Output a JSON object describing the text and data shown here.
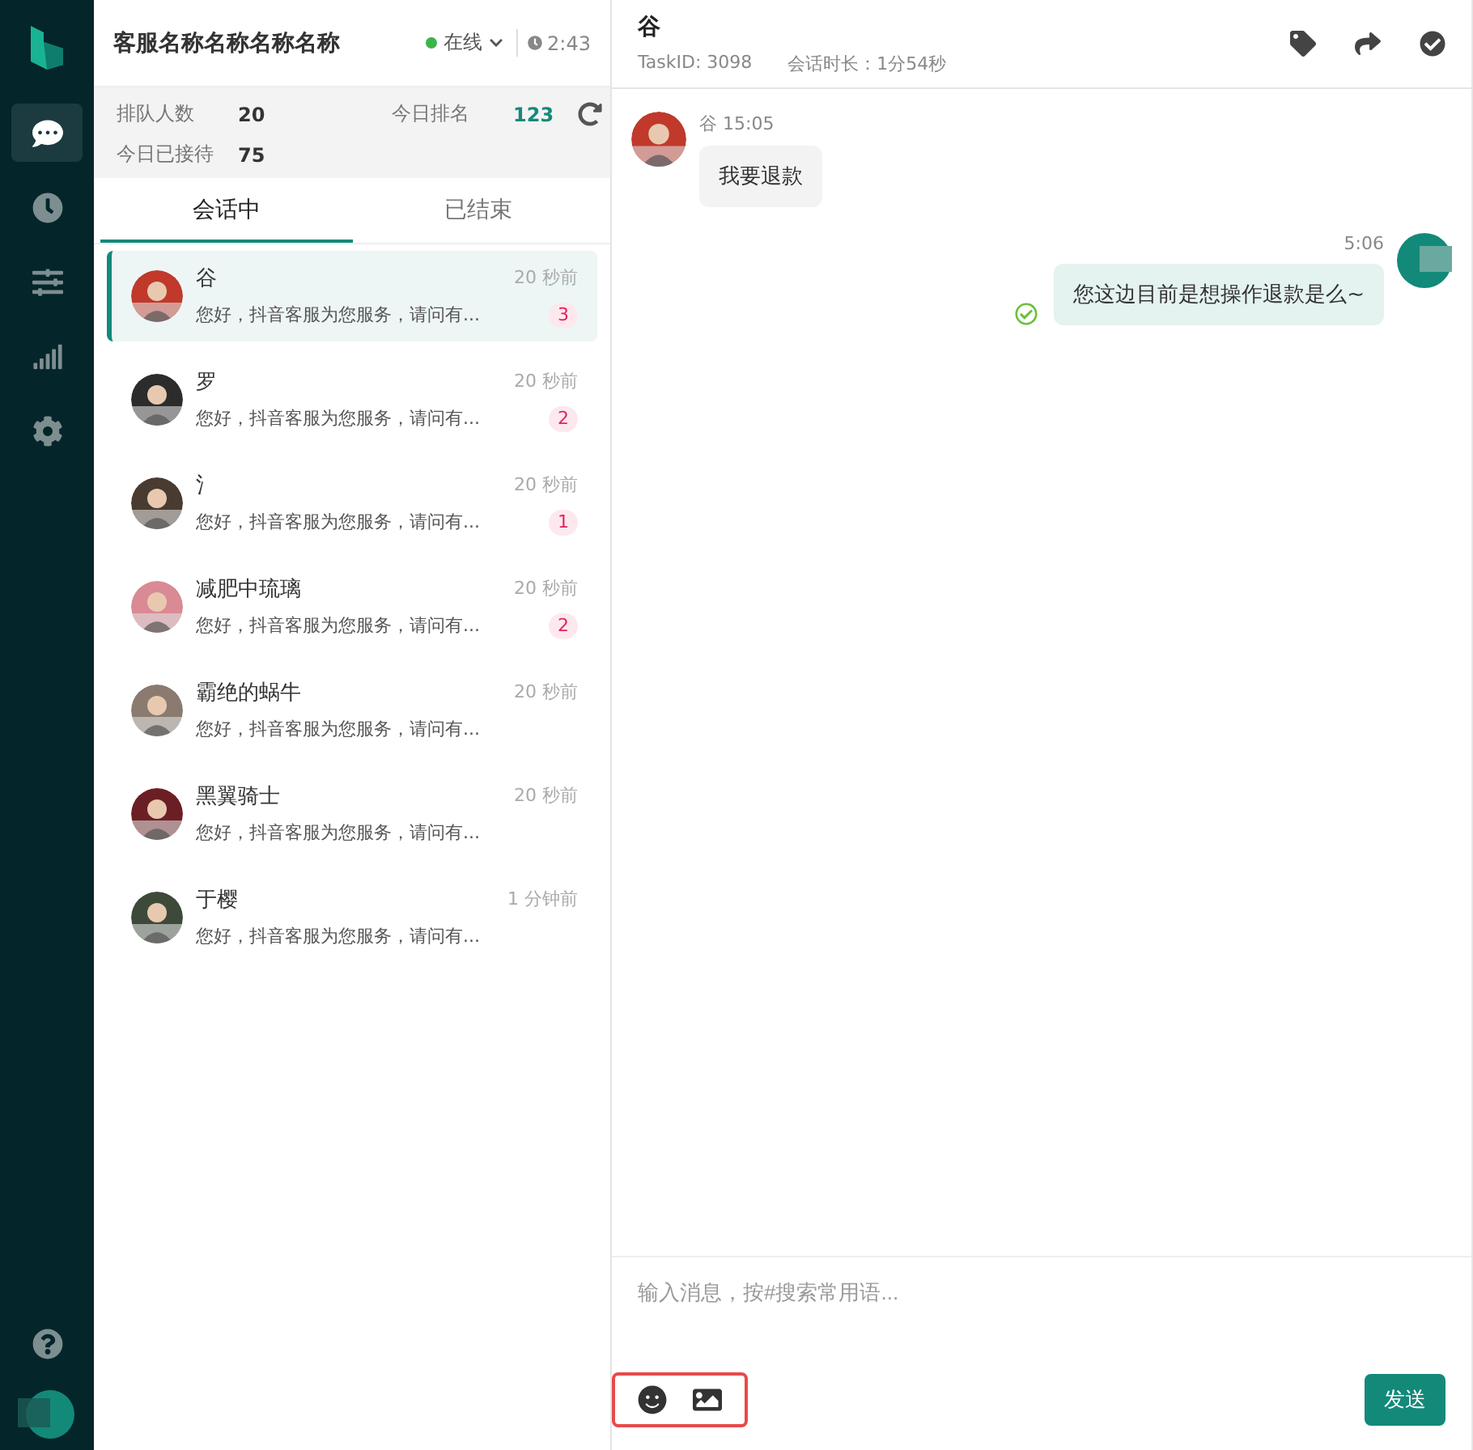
{
  "nav": [
    {
      "selected": true
    },
    {
      "selected": false
    },
    {
      "selected": false
    },
    {
      "selected": false
    },
    {
      "selected": false
    }
  ],
  "agent": {
    "name": "客服名称名称名称名称",
    "status": "在线",
    "timer": "2:43"
  },
  "stats": [
    {
      "label": "排队人数",
      "value": "20",
      "accent": false
    },
    {
      "label": "今日排名",
      "value": "123",
      "accent": true
    },
    {
      "label": "今日已接待",
      "value": "75",
      "accent": false
    }
  ],
  "tabs": [
    {
      "label": "会话中",
      "selected": true
    },
    {
      "label": "已结束",
      "selected": false
    }
  ],
  "conversations": [
    {
      "name": "谷",
      "time": "20 秒前",
      "preview": "您好，抖音客服为您服务，请问有...",
      "unread": "3",
      "selected": true,
      "color": "#c0392b"
    },
    {
      "name": "罗",
      "time": "20 秒前",
      "preview": "您好，抖音客服为您服务，请问有...",
      "unread": "2",
      "selected": false,
      "color": "#2c2c2c"
    },
    {
      "name": "氵",
      "time": "20 秒前",
      "preview": "您好，抖音客服为您服务，请问有...",
      "unread": "1",
      "selected": false,
      "color": "#4a3b30"
    },
    {
      "name": "减肥中琉璃",
      "time": "20 秒前",
      "preview": "您好，抖音客服为您服务，请问有...",
      "unread": "2",
      "selected": false,
      "color": "#d98a95"
    },
    {
      "name": "霸绝的蜗牛",
      "time": "20 秒前",
      "preview": "您好，抖音客服为您服务，请问有...",
      "selected": false,
      "color": "#8a7a70"
    },
    {
      "name": "黑翼骑士",
      "time": "20 秒前",
      "preview": "您好，抖音客服为您服务，请问有...",
      "selected": false,
      "color": "#6b1f25"
    },
    {
      "name": "于樱",
      "time": "1 分钟前",
      "preview": "您好，抖音客服为您服务，请问有...",
      "selected": false,
      "color": "#3d4a3a"
    }
  ],
  "chat": {
    "title": "谷",
    "task_id": "TaskID: 3098",
    "duration": "会话时长：1分54秒",
    "messages": [
      {
        "kind": "customer",
        "sender": "谷",
        "time": "15:05",
        "text": "我要退款"
      },
      {
        "kind": "agent",
        "time": "5:06",
        "text": "您这边目前是想操作退款是么~",
        "read": true
      }
    ],
    "placeholder": "输入消息，按#搜索常用语...",
    "send": "发送"
  }
}
